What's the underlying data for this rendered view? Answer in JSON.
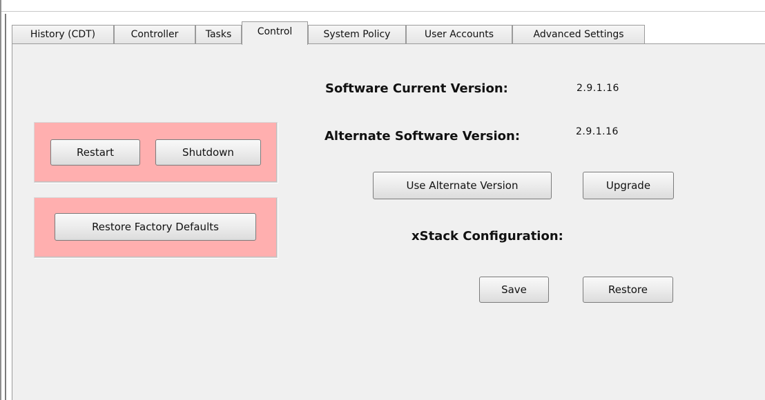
{
  "tabs": [
    {
      "label": "History (CDT)",
      "active": false
    },
    {
      "label": "Controller",
      "active": false
    },
    {
      "label": "Tasks",
      "active": false
    },
    {
      "label": "Control",
      "active": true
    },
    {
      "label": "System Policy",
      "active": false
    },
    {
      "label": "User Accounts",
      "active": false
    },
    {
      "label": "Advanced Settings",
      "active": false
    }
  ],
  "power_group": {
    "restart_label": "Restart",
    "shutdown_label": "Shutdown"
  },
  "factory_group": {
    "restore_defaults_label": "Restore Factory Defaults"
  },
  "software": {
    "current_label": "Software Current Version:",
    "current_value": "2.9.1.16",
    "alternate_label": "Alternate Software Version:",
    "alternate_value": "2.9.1.16",
    "use_alternate_label": "Use Alternate Version",
    "upgrade_label": "Upgrade"
  },
  "xstack": {
    "title": "xStack Configuration:",
    "save_label": "Save",
    "restore_label": "Restore"
  },
  "colors": {
    "panel_bg": "#f0f0f0",
    "group_bg": "#ffafaf"
  }
}
